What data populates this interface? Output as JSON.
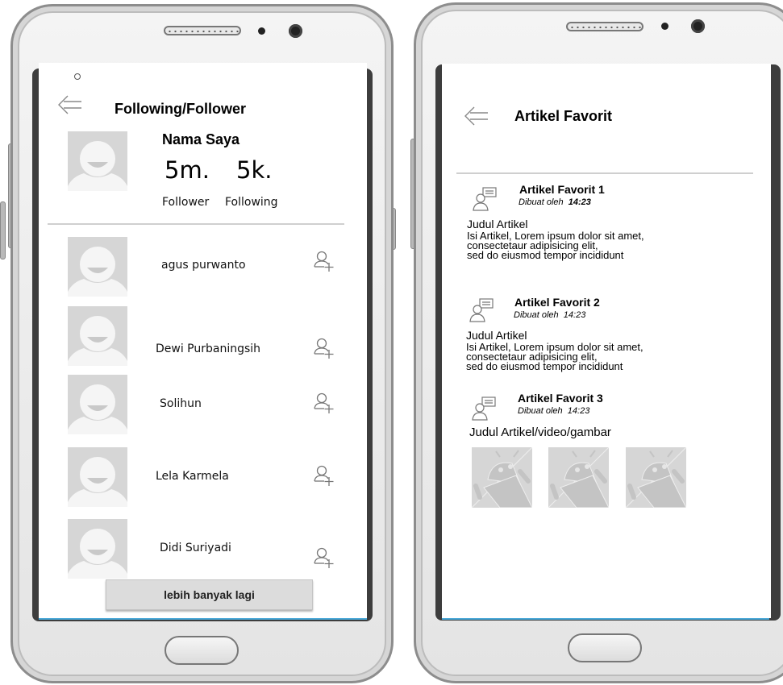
{
  "left_screen": {
    "title": "Following/Follower",
    "profile": {
      "name": "Nama Saya",
      "follower_count": "5m.",
      "following_count": "5k.",
      "follower_label": "Follower",
      "following_label": "Following"
    },
    "users": [
      {
        "name": "agus purwanto",
        "action_icon": "add-user-icon"
      },
      {
        "name": "Dewi Purbaningsih",
        "action_icon": "add-user-icon"
      },
      {
        "name": "Solihun",
        "action_icon": "add-user-icon"
      },
      {
        "name": "Lela Karmela",
        "action_icon": "add-user-icon"
      },
      {
        "name": "Didi Suriyadi",
        "action_icon": "add-user-icon"
      }
    ],
    "more_button": "lebih banyak lagi"
  },
  "right_screen": {
    "title": "Artikel Favorit",
    "articles": [
      {
        "title": "Artikel Favorit 1",
        "meta_prefix": "Dibuat oleh",
        "time": "14:23",
        "heading": "Judul Artikel",
        "body": [
          "Isi Artikel, Lorem ipsum dolor sit amet,",
          "consectetaur adipisicing elit,",
          "sed do eiusmod tempor incididunt"
        ]
      },
      {
        "title": "Artikel Favorit 2",
        "meta_prefix": "Dibuat oleh",
        "time": "14:23",
        "heading": "Judul Artikel",
        "body": [
          "Isi Artikel, Lorem ipsum dolor sit amet,",
          "consectetaur adipisicing elit,",
          "sed do eiusmod tempor incididunt"
        ]
      },
      {
        "title": "Artikel Favorit 3",
        "meta_prefix": "Dibuat oleh",
        "time": "14:23",
        "heading": "Judul Artikel/video/gambar",
        "media": [
          "image-placeholder-icon",
          "image-placeholder-icon",
          "image-placeholder-icon"
        ]
      }
    ]
  },
  "colors": {
    "accent_line": "#4aa8d8",
    "phone_frame": "#8d8d8d",
    "placeholder": "#d8d8d8"
  }
}
